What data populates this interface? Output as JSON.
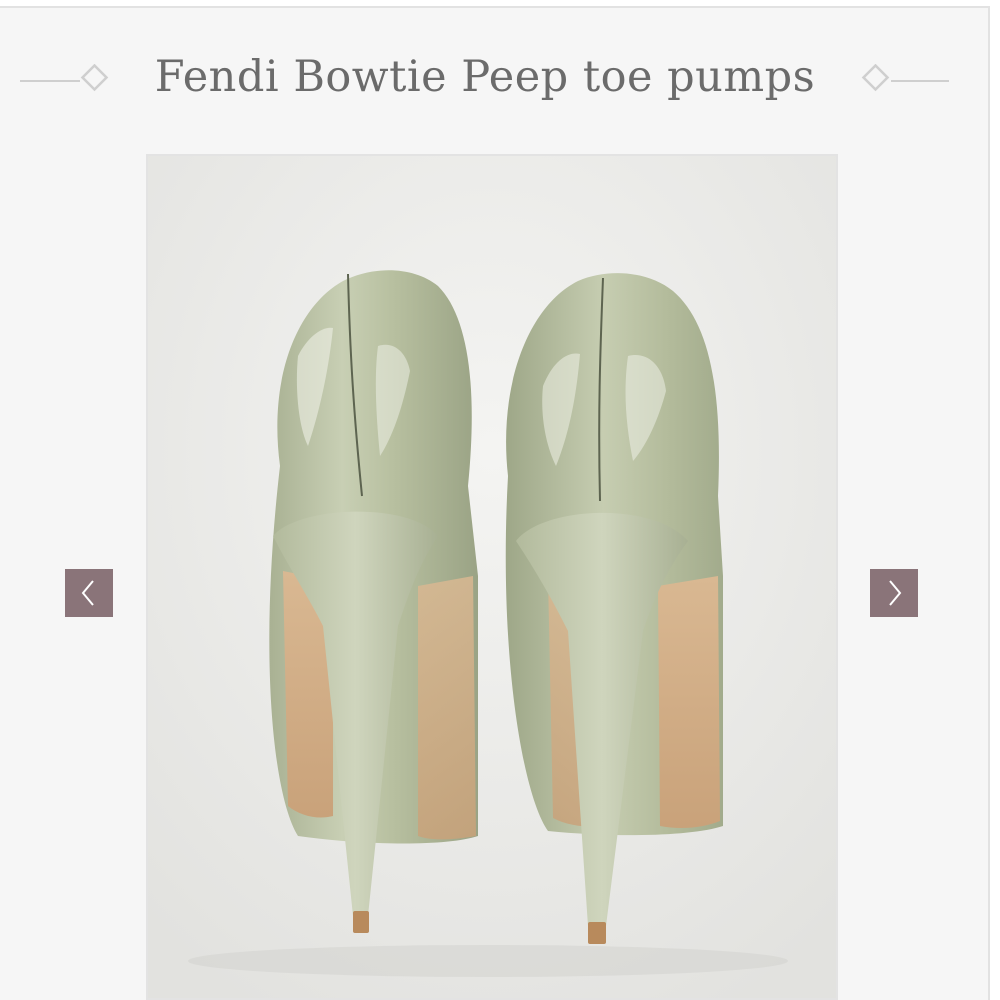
{
  "product": {
    "title": "Fendi Bowtie Peep toe pumps"
  },
  "gallery": {
    "image_subject": "sage green patent leather platform peep toe pumps, rear view",
    "prev_icon": "chevron-left-icon",
    "next_icon": "chevron-right-icon"
  },
  "colors": {
    "background": "#f6f6f6",
    "title_text": "#6b6b6b",
    "nav_button": "#8a7479",
    "ornament": "#cfcfcf"
  }
}
